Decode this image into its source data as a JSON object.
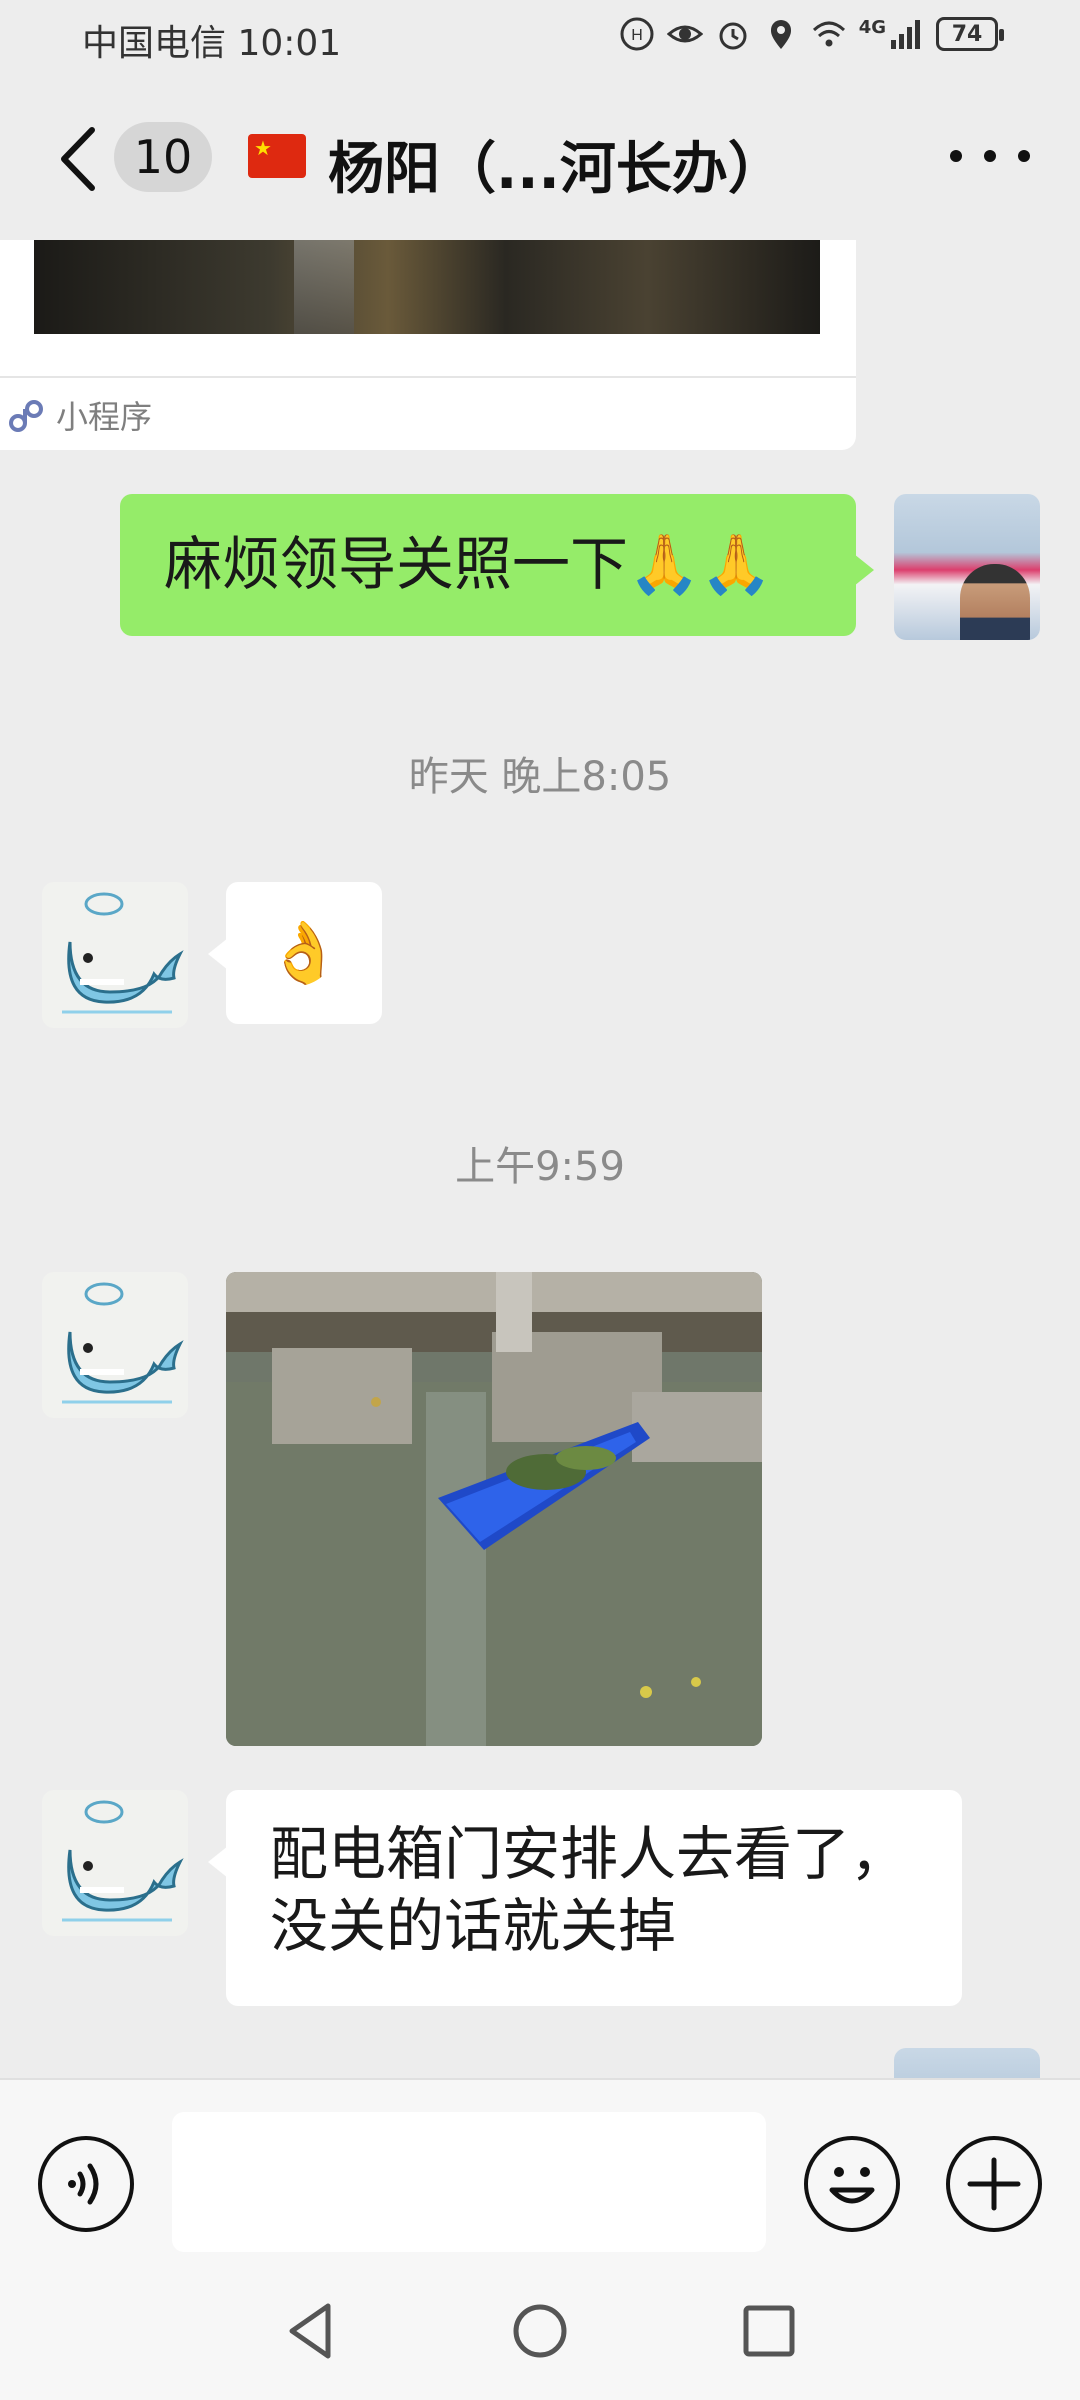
{
  "status_bar": {
    "carrier_time": "中国电信 10:01",
    "network": "4G",
    "battery": "74",
    "icons": [
      "hd-icon",
      "eye-icon",
      "alarm-icon",
      "location-icon",
      "wifi-icon",
      "signal-icon",
      "battery-icon"
    ]
  },
  "header": {
    "unread_count": "10",
    "title": "杨阳（...河长办）",
    "icons": [
      "back-arrow-icon",
      "china-flag-icon",
      "more-icon"
    ]
  },
  "messages": {
    "mini_program_label": "小程序",
    "outgoing_text": "麻烦领导关照一下🙏🙏",
    "time_yesterday": "昨天 晚上8:05",
    "ok_emoji": "👌",
    "time_today": "上午9:59",
    "incoming_text": "配电箱门安排人去看了，没关的话就关掉"
  },
  "input_bar": {
    "icons": [
      "voice-icon",
      "emoji-icon",
      "add-icon"
    ]
  },
  "nav_bar": {
    "icons": [
      "nav-back-icon",
      "nav-home-icon",
      "nav-recents-icon"
    ]
  },
  "colors": {
    "background": "#ededed",
    "outgoing_bubble": "#95ec69",
    "incoming_bubble": "#ffffff"
  }
}
